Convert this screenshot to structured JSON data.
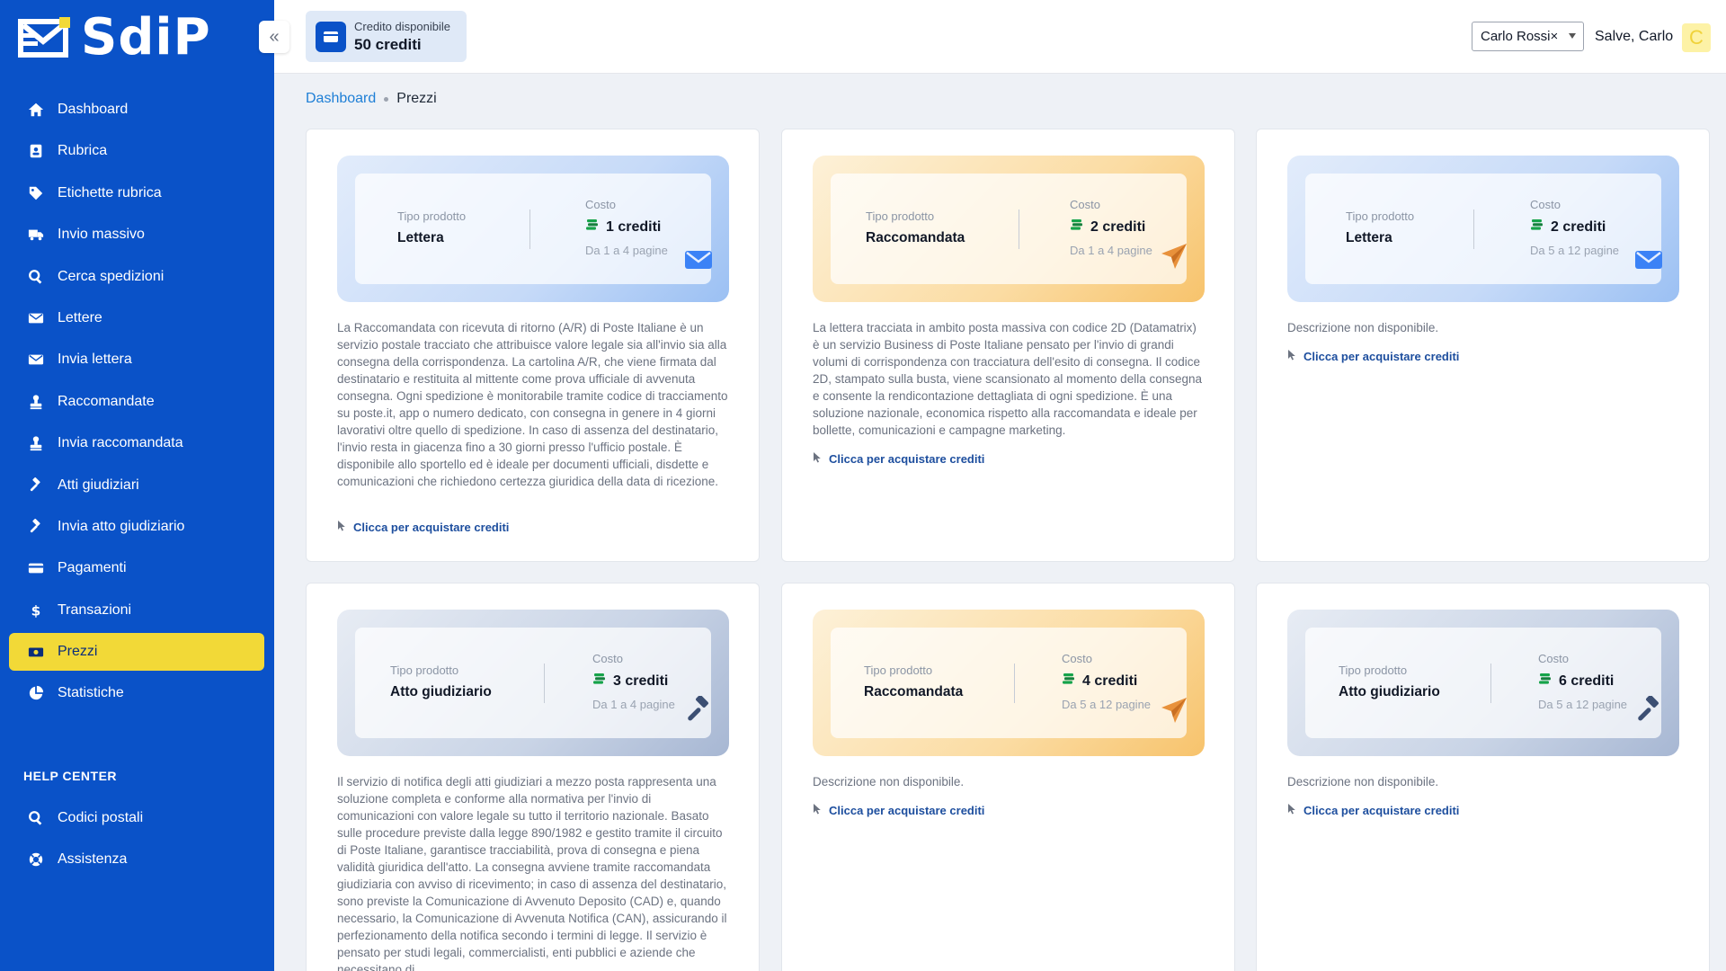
{
  "brand": {
    "name": "SdiP"
  },
  "colors": {
    "sidebar": "#0a52c8",
    "active": "#f2d937",
    "link": "#1d4e9e"
  },
  "sidebar": {
    "items": [
      {
        "label": "Dashboard",
        "icon": "home-icon"
      },
      {
        "label": "Rubrica",
        "icon": "address-book-icon"
      },
      {
        "label": "Etichette rubrica",
        "icon": "tag-icon"
      },
      {
        "label": "Invio massivo",
        "icon": "truck-icon"
      },
      {
        "label": "Cerca spedizioni",
        "icon": "search-icon"
      },
      {
        "label": "Lettere",
        "icon": "envelope-icon"
      },
      {
        "label": "Invia lettera",
        "icon": "envelope-icon"
      },
      {
        "label": "Raccomandate",
        "icon": "stamp-icon"
      },
      {
        "label": "Invia raccomandata",
        "icon": "stamp-icon"
      },
      {
        "label": "Atti giudiziari",
        "icon": "gavel-icon"
      },
      {
        "label": "Invia atto giudiziario",
        "icon": "gavel-icon"
      },
      {
        "label": "Pagamenti",
        "icon": "credit-card-icon"
      },
      {
        "label": "Transazioni",
        "icon": "dollar-icon"
      },
      {
        "label": "Prezzi",
        "icon": "money-icon",
        "active": true
      },
      {
        "label": "Statistiche",
        "icon": "pie-chart-icon"
      }
    ],
    "help_title": "HELP CENTER",
    "help_items": [
      {
        "label": "Codici postali",
        "icon": "search-icon"
      },
      {
        "label": "Assistenza",
        "icon": "lifebuoy-icon"
      }
    ]
  },
  "topbar": {
    "credit_label": "Credito disponibile",
    "credit_value": "50 crediti",
    "user_select": "Carlo Rossi",
    "user_clear": "×",
    "greeting": "Salve, Carlo",
    "avatar_initial": "C"
  },
  "breadcrumb": {
    "home": "Dashboard",
    "current": "Prezzi"
  },
  "labels": {
    "tipo": "Tipo prodotto",
    "costo": "Costo",
    "buy": "Clicca per acquistare crediti"
  },
  "cards": [
    {
      "product": "Lettera",
      "cost": "1 crediti",
      "pages": "Da 1 a 4 pagine",
      "theme": "blue",
      "icon": "envelope-icon",
      "description": "La Raccomandata con ricevuta di ritorno (A/R) di Poste Italiane è un servizio postale tracciato che attribuisce valore legale sia all'invio sia alla consegna della corrispondenza. La cartolina A/R, che viene firmata dal destinatario e restituita al mittente come prova ufficiale di avvenuta consegna. Ogni spedizione è monitorabile tramite codice di tracciamento su poste.it, app o numero dedicato, con consegna in genere in 4 giorni lavorativi oltre quello di spedizione. In caso di assenza del destinatario, l'invio resta in giacenza fino a 30 giorni presso l'ufficio postale. È disponibile allo sportello ed è ideale per documenti ufficiali, disdette e comunicazioni che richiedono certezza giuridica della data di ricezione."
    },
    {
      "product": "Raccomandata",
      "cost": "2 crediti",
      "pages": "Da 1 a 4 pagine",
      "theme": "orange",
      "icon": "paper-plane-icon",
      "description": "La lettera tracciata in ambito posta massiva con codice 2D (Datamatrix) è un servizio Business di Poste Italiane pensato per l'invio di grandi volumi di corrispondenza con tracciatura dell'esito di consegna. Il codice 2D, stampato sulla busta, viene scansionato al momento della consegna e consente la rendicontazione dettagliata di ogni spedizione. È una soluzione nazionale, economica rispetto alla raccomandata e ideale per bollette, comunicazioni e campagne marketing."
    },
    {
      "product": "Lettera",
      "cost": "2 crediti",
      "pages": "Da 5 a 12 pagine",
      "theme": "blue",
      "icon": "envelope-icon",
      "description": "Descrizione non disponibile."
    },
    {
      "product": "Atto giudiziario",
      "cost": "3 crediti",
      "pages": "Da 1 a 4 pagine",
      "theme": "slate",
      "icon": "gavel-icon",
      "description": "Il servizio di notifica degli atti giudiziari a mezzo posta rappresenta una soluzione completa e conforme alla normativa per l'invio di comunicazioni con valore legale su tutto il territorio nazionale. Basato sulle procedure previste dalla legge 890/1982 e gestito tramite il circuito di Poste Italiane, garantisce tracciabilità, prova di consegna e piena validità giuridica dell'atto. La consegna avviene tramite raccomandata giudiziaria con avviso di ricevimento; in caso di assenza del destinatario, sono previste la Comunicazione di Avvenuto Deposito (CAD) e, quando necessario, la Comunicazione di Avvenuta Notifica (CAN), assicurando il perfezionamento della notifica secondo i termini di legge. Il servizio è pensato per studi legali, commercialisti, enti pubblici e aziende che necessitano di"
    },
    {
      "product": "Raccomandata",
      "cost": "4 crediti",
      "pages": "Da 5 a 12 pagine",
      "theme": "orange",
      "icon": "paper-plane-icon",
      "description": "Descrizione non disponibile."
    },
    {
      "product": "Atto giudiziario",
      "cost": "6 crediti",
      "pages": "Da 5 a 12 pagine",
      "theme": "slate",
      "icon": "gavel-icon",
      "description": "Descrizione non disponibile."
    }
  ]
}
